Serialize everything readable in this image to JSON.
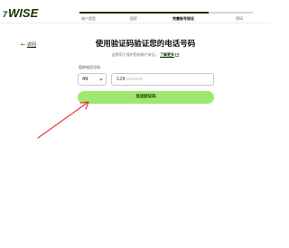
{
  "header": {
    "logo_flag": "7",
    "logo_text": "WISE",
    "steps": [
      "账户类型",
      "国家",
      "完善账号验证",
      "密码"
    ],
    "active_step": 2
  },
  "back": {
    "label": "返回"
  },
  "main": {
    "title": "使用验证码验证您的电话号码",
    "subtitle": "这将用于保护您的账户安全。",
    "learn_more": "了解更多",
    "field_label": "您的电话号码",
    "country_code": "49",
    "phone_prefix": "128"
  },
  "button": {
    "send_code": "发送验证码"
  },
  "colors": {
    "brand_dark": "#163300",
    "accent": "#9fe870",
    "annotation_arrow": "#e5393b"
  }
}
